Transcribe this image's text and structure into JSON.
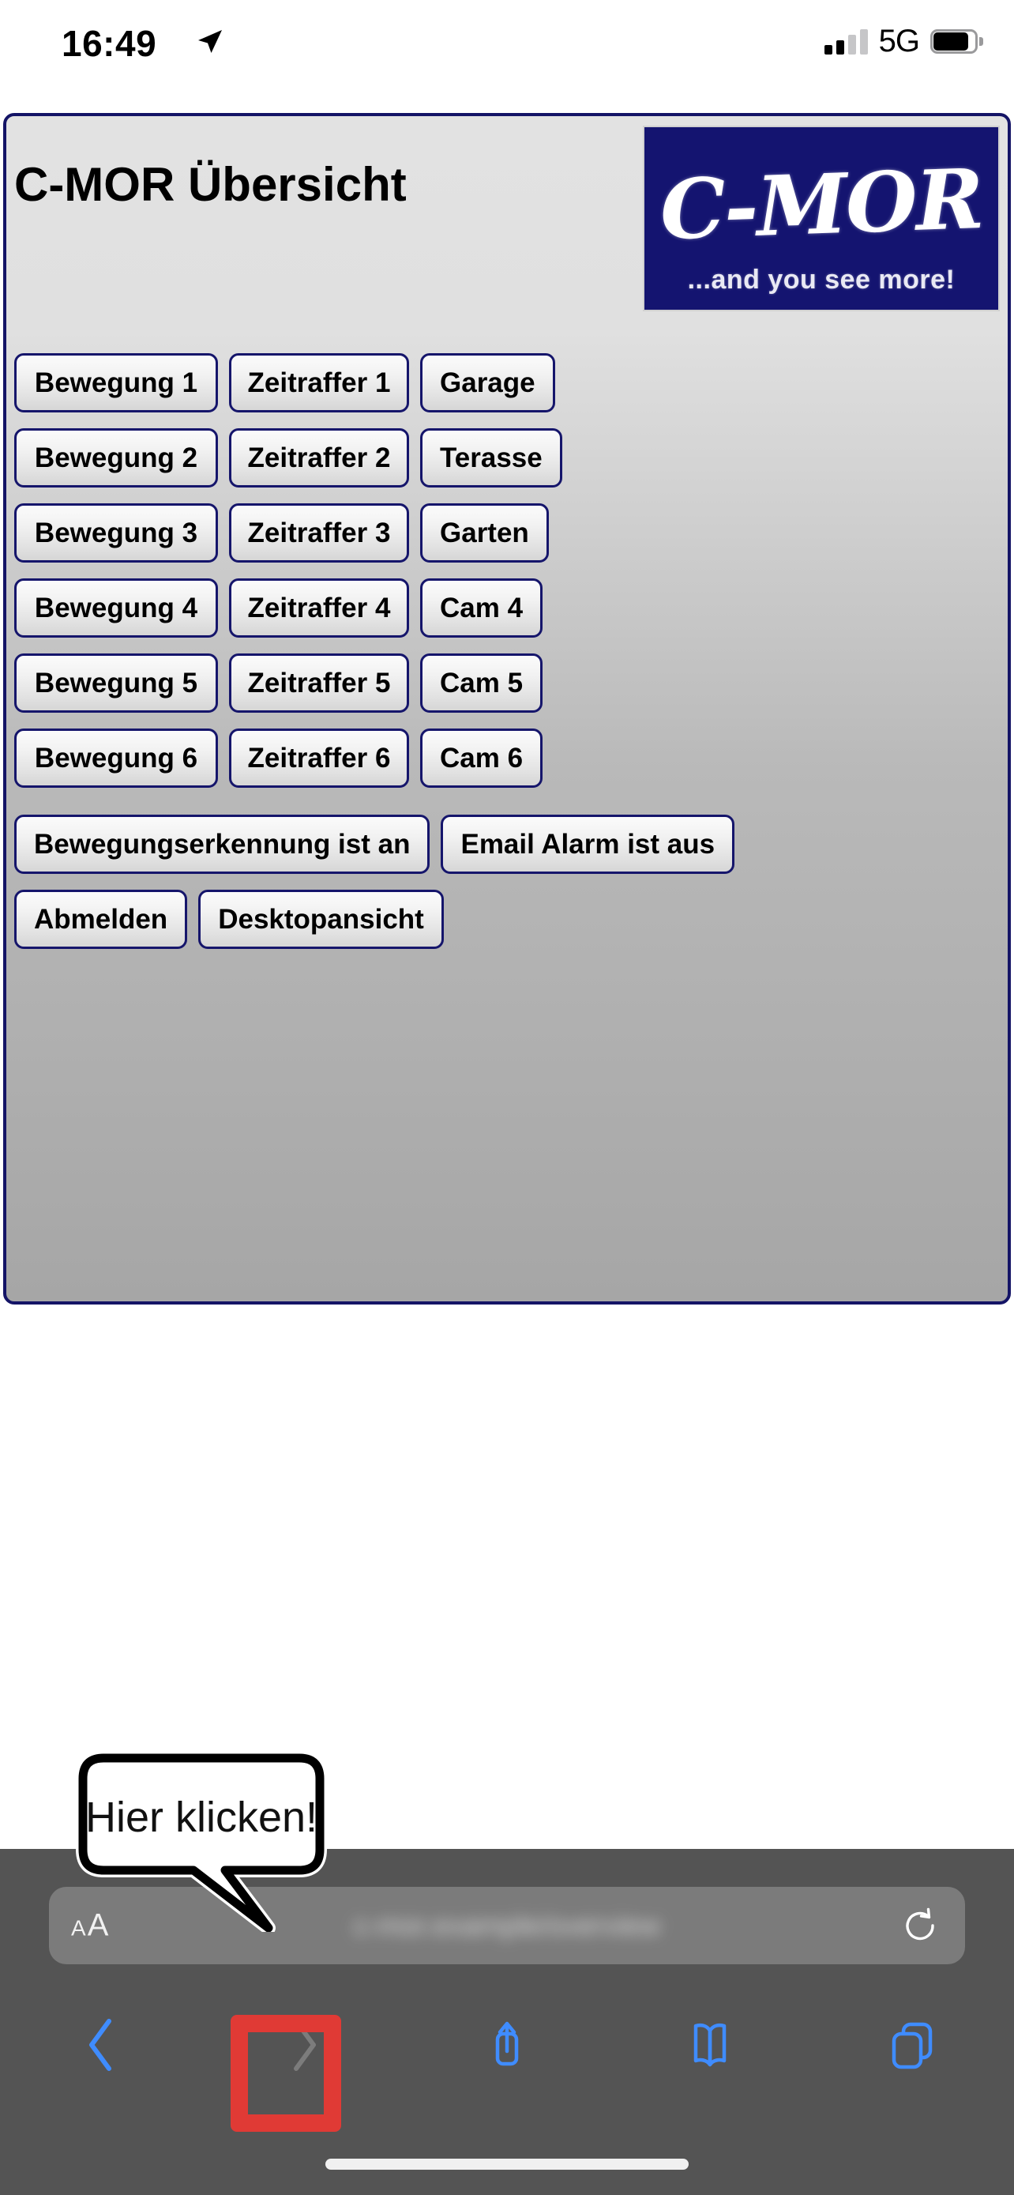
{
  "status_bar": {
    "time": "16:49",
    "location_icon": "location-arrow-icon",
    "network": "5G",
    "signal_icon": "cellular-signal-icon",
    "battery_icon": "battery-icon"
  },
  "web_page": {
    "title": "C-MOR Übersicht",
    "logo": {
      "wordmark": "C-MOR",
      "tagline": "...and you see more!",
      "background_color": "#141470",
      "text_color": "#ffffff"
    },
    "border_color": "#141466",
    "button_border_color": "#15156b",
    "rows": [
      {
        "motion": "Bewegung 1",
        "timelapse": "Zeitraffer 1",
        "camera": "Garage"
      },
      {
        "motion": "Bewegung 2",
        "timelapse": "Zeitraffer 2",
        "camera": "Terasse"
      },
      {
        "motion": "Bewegung 3",
        "timelapse": "Zeitraffer 3",
        "camera": "Garten"
      },
      {
        "motion": "Bewegung 4",
        "timelapse": "Zeitraffer 4",
        "camera": "Cam 4"
      },
      {
        "motion": "Bewegung 5",
        "timelapse": "Zeitraffer 5",
        "camera": "Cam 5"
      },
      {
        "motion": "Bewegung 6",
        "timelapse": "Zeitraffer 6",
        "camera": "Cam 6"
      }
    ],
    "status_buttons": {
      "motion_detection": "Bewegungserkennung ist an",
      "email_alarm": "Email Alarm ist aus"
    },
    "footer_buttons": {
      "logout": "Abmelden",
      "desktop_view": "Desktopansicht"
    }
  },
  "callout": {
    "text": "Hier klicken!",
    "highlight_color": "#e03a35",
    "target": "share-button"
  },
  "safari": {
    "text_size_small": "A",
    "text_size_large": "A",
    "url_text": "blurred-url",
    "reload_icon": "reload-icon",
    "nav": {
      "back": "back-chevron-icon",
      "forward": "forward-chevron-icon",
      "share": "share-icon",
      "bookmarks": "bookmarks-icon",
      "tabs": "tabs-icon"
    },
    "toolbar_color": "#545454",
    "urlbar_color": "#7b7b7b",
    "accent_color": "#3f8cff"
  }
}
